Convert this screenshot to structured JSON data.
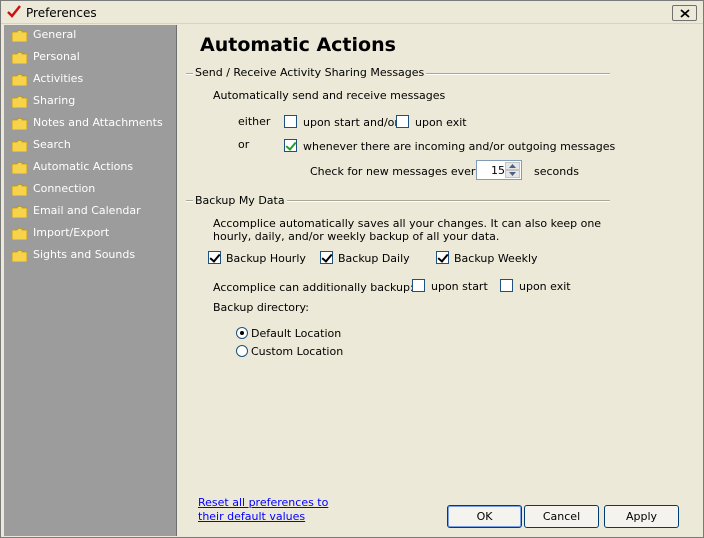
{
  "window": {
    "title": "Preferences"
  },
  "sidebar": {
    "items": [
      {
        "label": "General"
      },
      {
        "label": "Personal"
      },
      {
        "label": "Activities"
      },
      {
        "label": "Sharing"
      },
      {
        "label": "Notes and Attachments"
      },
      {
        "label": "Search"
      },
      {
        "label": "Automatic Actions"
      },
      {
        "label": "Connection"
      },
      {
        "label": "Email and Calendar"
      },
      {
        "label": "Import/Export"
      },
      {
        "label": "Sights and Sounds"
      }
    ]
  },
  "page": {
    "title": "Automatic Actions",
    "sharing": {
      "heading": "Send / Receive Activity Sharing Messages",
      "intro": "Automatically send and receive messages",
      "either": "either",
      "or": "or",
      "upon_start": "upon start and/or",
      "upon_exit": "upon exit",
      "whenever": "whenever there are incoming and/or outgoing messages",
      "check_label": "Check for new messages every:",
      "check_value": "15",
      "seconds": "seconds",
      "upon_start_checked": false,
      "upon_exit_checked": false,
      "whenever_checked": true
    },
    "backup": {
      "heading": "Backup My Data",
      "desc_line1": "Accomplice automatically saves all your changes. It can also keep one",
      "desc_line2": "hourly, daily, and/or weekly backup of all your data.",
      "hourly": "Backup Hourly",
      "daily": "Backup Daily",
      "weekly": "Backup Weekly",
      "hourly_checked": true,
      "daily_checked": true,
      "weekly_checked": true,
      "additional": "Accomplice can additionally backup:",
      "upon_start": "upon start",
      "upon_exit": "upon exit",
      "directory": "Backup directory:",
      "default_location": "Default Location",
      "custom_location": "Custom Location",
      "selected_location": "Default Location"
    }
  },
  "footer": {
    "reset_line1": "Reset all preferences to",
    "reset_line2": "their default values",
    "ok": "OK",
    "cancel": "Cancel",
    "apply": "Apply"
  }
}
